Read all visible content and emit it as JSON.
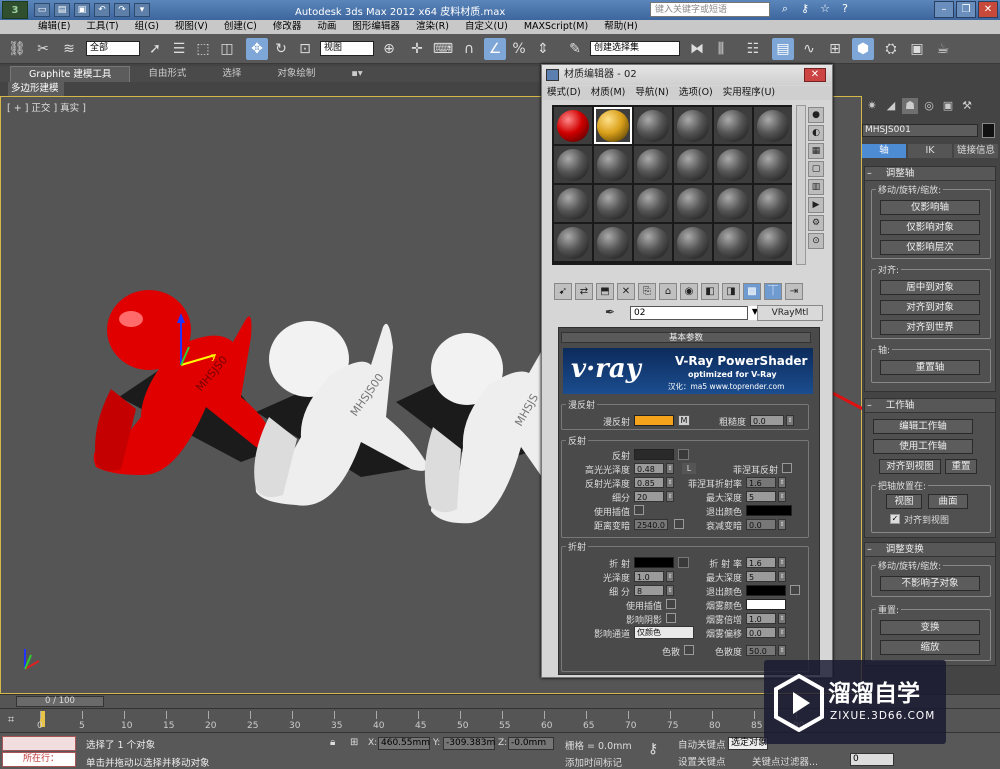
{
  "titlebar": {
    "app_title": "Autodesk 3ds Max  2012 x64        皮料材质.max",
    "search_placeholder": "键入关键字或短语",
    "logo_text": "3"
  },
  "menubar": [
    "编辑(E)",
    "工具(T)",
    "组(G)",
    "视图(V)",
    "创建(C)",
    "修改器",
    "动画",
    "图形编辑器",
    "渲染(R)",
    "自定义(U)",
    "MAXScript(M)",
    "帮助(H)"
  ],
  "toolbar": {
    "selection_set": "全部",
    "ref_coord": "视图",
    "named_selection": "创建选择集"
  },
  "ribbon": {
    "tabs": [
      "Graphite 建模工具",
      "自由形式",
      "选择",
      "对象绘制"
    ],
    "subtab": "多边形建模"
  },
  "viewport": {
    "label": "[ + ] 正交 ] 真实 ]"
  },
  "material_editor": {
    "title": "材质编辑器 - 02",
    "menu": [
      "模式(D)",
      "材质(M)",
      "导航(N)",
      "选项(O)",
      "实用程序(U)"
    ],
    "material_name": "02",
    "material_type": "VRayMtl",
    "rollout_title": "基本参数",
    "vray_banner": {
      "headline": "V-Ray PowerShader",
      "subline": "optimized for V-Ray",
      "credit": "汉化：ma5 www.toprender.com",
      "wordmark": "v·ray"
    },
    "diffuse": {
      "group": "漫反射",
      "label": "漫反射",
      "map_button": "M",
      "roughness_label": "粗糙度",
      "roughness": "0.0",
      "color": "#f5a31a"
    },
    "reflection": {
      "group": "反射",
      "reflect_label": "反射",
      "hilight_gloss_label": "高光光泽度",
      "hilight_gloss": "0.48",
      "lock_label": "L",
      "fresnel_label": "菲涅耳反射",
      "refl_gloss_label": "反射光泽度",
      "refl_gloss": "0.85",
      "fresnel_ior_label": "菲涅耳折射率",
      "fresnel_ior": "1.6",
      "subdivs_label": "细分",
      "subdivs": "20",
      "max_depth_label": "最大深度",
      "max_depth": "5",
      "use_interp_label": "使用插值",
      "exit_color_label": "退出颜色",
      "dim_distance_label": "距离变暗",
      "dim_distance": "2540.0",
      "dim_falloff_label": "衰减变暗",
      "dim_falloff": "0.0"
    },
    "refraction": {
      "group": "折射",
      "refract_label": "折 射",
      "ior_label": "折 射 率",
      "ior": "1.6",
      "gloss_label": "光泽度",
      "gloss": "1.0",
      "max_depth_label": "最大深度",
      "max_depth": "5",
      "subdivs_label": "细 分",
      "subdivs": "8",
      "exit_color_label": "退出颜色",
      "use_interp_label": "使用插值",
      "fog_color_label": "烟雾颜色",
      "affect_shadows_label": "影响阴影",
      "fog_mult_label": "烟雾倍增",
      "fog_mult": "1.0",
      "affect_channels_label": "影响通道",
      "affect_channels_value": "仅颜色",
      "fog_bias_label": "烟雾偏移",
      "fog_bias": "0.0",
      "dispersion_label": "色散",
      "abbe_label": "色散度",
      "abbe": "50.0"
    }
  },
  "command_panel": {
    "object_name": "MHSJS001",
    "tabs": [
      "轴",
      "IK",
      "链接信息"
    ],
    "adjust_pivot": {
      "title": "调整轴",
      "move_group": "移动/旋转/缩放:",
      "buttons": [
        "仅影响轴",
        "仅影响对象",
        "仅影响层次"
      ],
      "align_group": "对齐:",
      "align_buttons": [
        "居中到对象",
        "对齐到对象",
        "对齐到世界"
      ],
      "pivot_group": "轴:",
      "reset_button": "重置轴"
    },
    "working_pivot": {
      "title": "工作轴",
      "buttons": [
        "编辑工作轴",
        "使用工作轴"
      ],
      "align_view": "对齐到视图",
      "reset": "重置",
      "place_group": "把轴放置在:",
      "view_btn": "视图",
      "surface_btn": "曲面",
      "align_check": "对齐到视图"
    },
    "adjust_transform": {
      "title": "调整变换",
      "move_group": "移动/旋转/缩放:",
      "dont_affect": "不影响子对象",
      "reset_group": "重置:",
      "transform_btn": "变换",
      "scale_btn": "缩放"
    }
  },
  "timeline": {
    "slider": "0 / 100",
    "ticks": [
      "0",
      "5",
      "10",
      "15",
      "20",
      "25",
      "30",
      "35",
      "40",
      "45",
      "50",
      "55",
      "60",
      "65",
      "70",
      "75",
      "80",
      "85",
      "90"
    ]
  },
  "status": {
    "listener": "所在行：",
    "selected": "选择了 1 个对象",
    "prompt": "单击并拖动以选择并移动对象",
    "x_label": "X:",
    "x": "460.55mm",
    "y_label": "Y:",
    "y": "-309.383m",
    "z_label": "Z:",
    "z": "-0.0mm",
    "grid": "栅格 = 0.0mm",
    "auto_key": "自动关键点",
    "set_key": "设置关键点",
    "selected_dd": "选定对象",
    "add_time_tag": "添加时间标记",
    "key_filters": "关键点过滤器...",
    "frame": "0"
  },
  "watermark": {
    "brand": "溜溜自学",
    "url": "ZIXUE.3D66.COM"
  },
  "scene_text": {
    "engrave1": "MHSJS0",
    "engrave2": "MHSJS00",
    "engrave3": "MHSJS"
  },
  "colors": {
    "accent": "#4d8bd3",
    "red_model": "#e00000",
    "annotation": "#dd1111",
    "diffuse_swatch": "#f5a31a"
  }
}
